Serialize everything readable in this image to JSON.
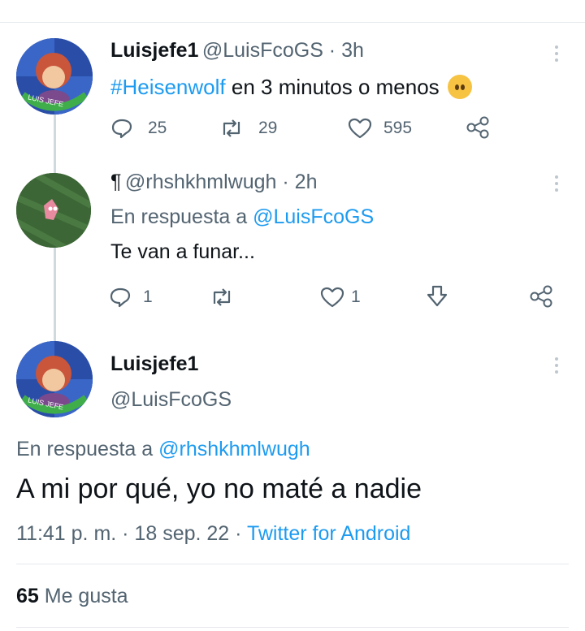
{
  "tweet1": {
    "name": "Luisjefe1",
    "handle_time": "@LuisFcoGS · 3h",
    "hashtag": "#Heisenwolf",
    "text": " en 3 minutos o menos",
    "emoji": "worried-face",
    "replies": "25",
    "retweets": "29",
    "likes": "595",
    "avatar_text": "LUIS JEFE"
  },
  "reply1": {
    "name": "¶",
    "handle_time": "@rhshkhmlwugh · 2h",
    "replying_prefix": "En respuesta a ",
    "replying_to": "@LuisFcoGS",
    "text": "Te van a funar...",
    "replies": "1",
    "likes": "1"
  },
  "main": {
    "name": "Luisjefe1",
    "handle": "@LuisFcoGS",
    "replying_prefix": "En respuesta a ",
    "replying_to": "@rhshkhmlwugh",
    "text": "A mi por qué, yo no maté a nadie",
    "timestamp": "11:41 p. m. · 18 sep. 22 · ",
    "source": "Twitter for Android",
    "likes_count": "65",
    "likes_label": " Me gusta"
  },
  "colors": {
    "link": "#1d9bf0",
    "secondary": "#536471",
    "thread_line": "#cfd9de"
  }
}
